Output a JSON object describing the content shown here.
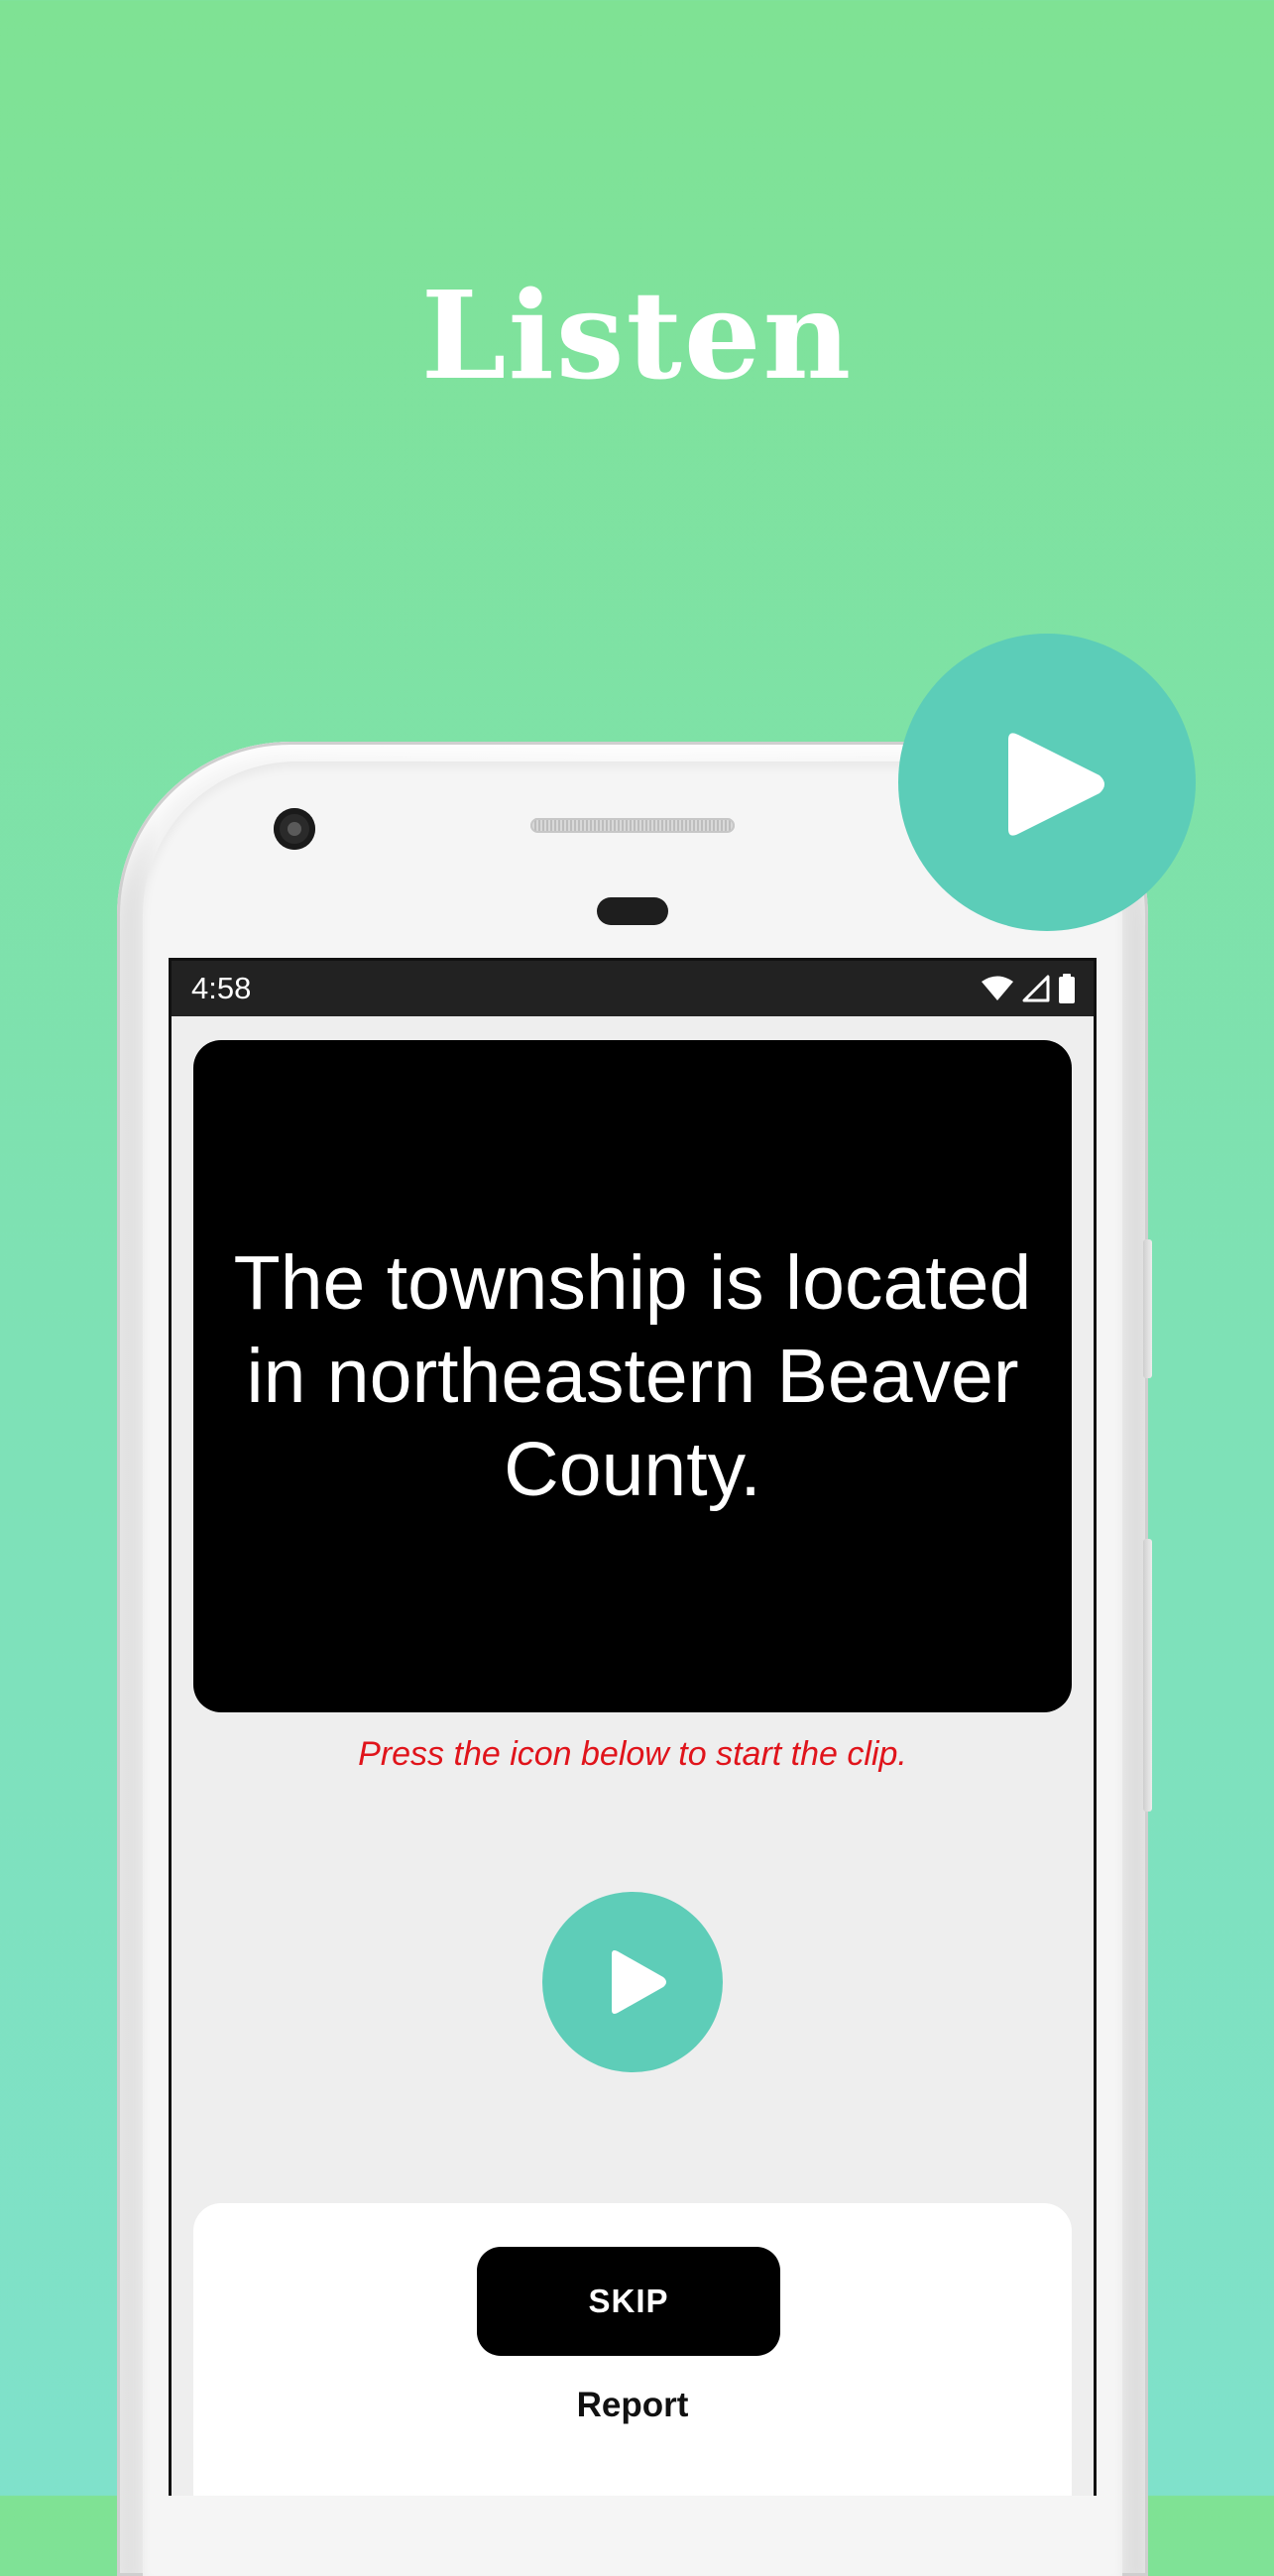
{
  "promo": {
    "title": "Listen"
  },
  "status_bar": {
    "time": "4:58",
    "icons": [
      "wifi-icon",
      "cell-signal-icon",
      "battery-icon"
    ]
  },
  "clip": {
    "sentence": "The township is located in northeastern Beaver County.",
    "hint": "Press the icon below to start the clip."
  },
  "actions": {
    "skip_label": "SKIP",
    "report_label": "Report"
  },
  "colors": {
    "background_top": "#7fe294",
    "background_bottom": "#7fe1cb",
    "play_accent": "#5ecdb8",
    "hint_red": "#e0141b",
    "card_black": "#000000"
  },
  "icons": {
    "large_badge": "play-icon",
    "clip_button": "play-icon"
  }
}
